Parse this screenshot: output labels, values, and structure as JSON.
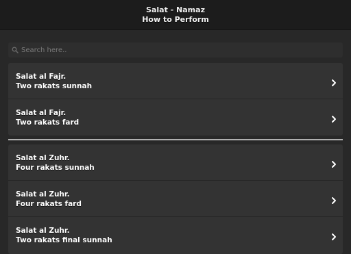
{
  "header": {
    "title_line1": "Salat - Namaz",
    "title_line2": "How to Perform"
  },
  "search": {
    "placeholder": "Search here..",
    "value": "",
    "icon": "search-icon"
  },
  "sections": [
    {
      "items": [
        {
          "line1": "Salat al Fajr.",
          "line2": "Two rakats sunnah"
        },
        {
          "line1": "Salat al Fajr.",
          "line2": "Two rakats fard"
        }
      ]
    },
    {
      "items": [
        {
          "line1": "Salat al Zuhr.",
          "line2": "Four rakats sunnah"
        },
        {
          "line1": "Salat al Zuhr.",
          "line2": "Four rakats fard"
        },
        {
          "line1": "Salat al Zuhr.",
          "line2": "Two rakats final sunnah"
        }
      ]
    }
  ],
  "colors": {
    "background": "#282828",
    "header": "#1c1c1c",
    "list": "#333333",
    "divider": "#b0b0b0"
  }
}
